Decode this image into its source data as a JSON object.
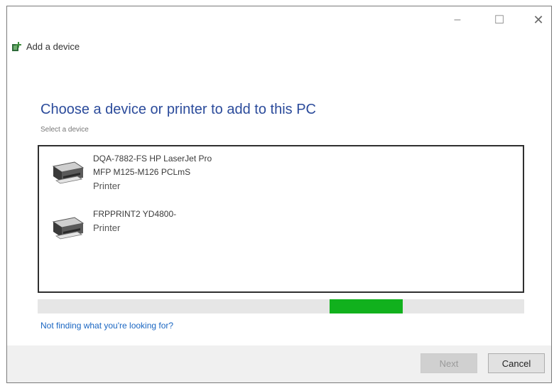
{
  "window": {
    "title": "Add a device",
    "controls": {
      "minimize": "–",
      "maximize": "☐",
      "close": "✕"
    }
  },
  "main": {
    "heading": "Choose a device or printer to add to this PC",
    "subheading": "Select a device"
  },
  "devices": [
    {
      "line1": "DQA-7882-FS  HP LaserJet Pro",
      "line2": "MFP M125-M126 PCLmS",
      "type": "Printer",
      "icon": "printer-icon"
    },
    {
      "line1": "FRPPRINT2  YD4800-",
      "line2": "",
      "type": "Printer",
      "icon": "printer-icon"
    }
  ],
  "progress": {
    "value": 0.6,
    "span": 0.15,
    "color": "#11b11d"
  },
  "help_link": "Not finding what you're looking for?",
  "footer": {
    "next_label": "Next",
    "cancel_label": "Cancel"
  },
  "colors": {
    "heading": "#2b4b9b",
    "link": "#1a66c2",
    "footer_bg": "#f0f0f0"
  }
}
